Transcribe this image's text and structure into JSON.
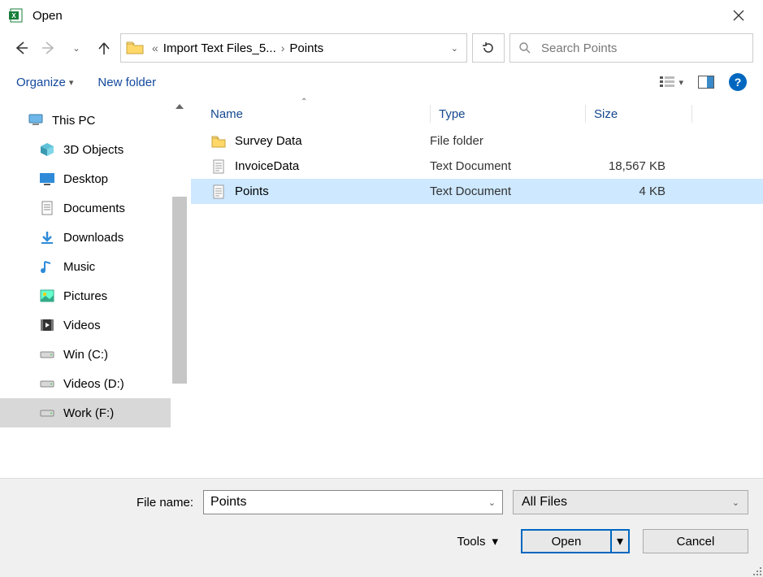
{
  "title": "Open",
  "breadcrumb": {
    "ellipsis": "«",
    "part1": "Import Text Files_5...",
    "part2": "Points"
  },
  "search": {
    "placeholder": "Search Points"
  },
  "toolbar": {
    "organize": "Organize",
    "new_folder": "New folder"
  },
  "tree": {
    "root": "This PC",
    "items": [
      {
        "label": "3D Objects",
        "icon": "3d"
      },
      {
        "label": "Desktop",
        "icon": "desktop"
      },
      {
        "label": "Documents",
        "icon": "doc"
      },
      {
        "label": "Downloads",
        "icon": "download"
      },
      {
        "label": "Music",
        "icon": "music"
      },
      {
        "label": "Pictures",
        "icon": "pictures"
      },
      {
        "label": "Videos",
        "icon": "videos"
      },
      {
        "label": "Win (C:)",
        "icon": "drive"
      },
      {
        "label": "Videos (D:)",
        "icon": "drive"
      },
      {
        "label": "Work (F:)",
        "icon": "drive",
        "selected": true
      }
    ]
  },
  "columns": {
    "name": "Name",
    "type": "Type",
    "size": "Size"
  },
  "files": [
    {
      "name": "Survey Data",
      "type": "File folder",
      "size": "",
      "icon": "folder"
    },
    {
      "name": "InvoiceData",
      "type": "Text Document",
      "size": "18,567 KB",
      "icon": "text"
    },
    {
      "name": "Points",
      "type": "Text Document",
      "size": "4 KB",
      "icon": "text",
      "selected": true
    }
  ],
  "footer": {
    "file_name_label": "File name:",
    "file_name_value": "Points",
    "filter": "All Files",
    "tools": "Tools",
    "open": "Open",
    "cancel": "Cancel"
  }
}
